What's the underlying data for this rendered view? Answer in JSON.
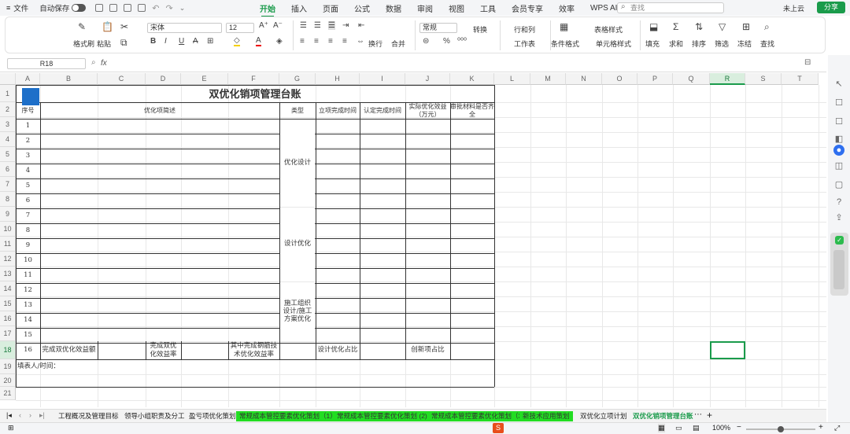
{
  "menu": {
    "file": "文件",
    "autosave": "自动保存"
  },
  "tabs": [
    "开始",
    "插入",
    "页面",
    "公式",
    "数据",
    "审阅",
    "视图",
    "工具",
    "会员专享",
    "效率",
    "WPS AI"
  ],
  "search": {
    "placeholder": "查找"
  },
  "header": {
    "cloud": "未上云",
    "share": "分享"
  },
  "ribbon": {
    "format_painter": "格式刷",
    "paste": "粘贴",
    "font": "宋体",
    "size": "12",
    "wrap": "换行",
    "merge": "合并",
    "number_format": "常规",
    "convert": "转换",
    "rows_cols": "行和列",
    "worksheet": "工作表",
    "cond_format": "条件格式",
    "table_style": "表格样式",
    "cell_style": "单元格样式",
    "fill": "填充",
    "sum": "求和",
    "sort": "排序",
    "filter": "筛选",
    "freeze": "冻结",
    "find": "查找"
  },
  "formula": {
    "cell_ref": "R18",
    "fx": "fx"
  },
  "columns": [
    "A",
    "B",
    "C",
    "D",
    "E",
    "F",
    "G",
    "H",
    "I",
    "J",
    "K",
    "L",
    "M",
    "N",
    "O",
    "P",
    "Q",
    "R",
    "S",
    "T"
  ],
  "rows": [
    "1",
    "2",
    "3",
    "4",
    "5",
    "6",
    "7",
    "8",
    "9",
    "10",
    "11",
    "12",
    "13",
    "14",
    "15",
    "16",
    "17",
    "18",
    "19",
    "20",
    "21"
  ],
  "sheet": {
    "title": "双优化销项管理台账",
    "headers": [
      "序号",
      "优化项简述",
      "类型",
      "立项完成时间",
      "认定完成时间",
      "实际优化效益（万元）",
      "审批材料是否齐全"
    ],
    "row_numbers": [
      "1",
      "2",
      "3",
      "4",
      "5",
      "6",
      "7",
      "8",
      "9",
      "10",
      "11",
      "12",
      "13",
      "14",
      "15"
    ],
    "types": [
      "优化设计",
      "设计优化",
      "施工组织设计/施工方案优化"
    ],
    "summary_index": "16",
    "summary_labels": [
      "完成双优化效益额",
      "完成双优化效益率",
      "其中完成钢筋技术优化效益率",
      "设计优化占比",
      "创新项占比"
    ],
    "footer": "填表人/时间："
  },
  "sheet_tabs": [
    "工程概况及管理目标",
    "领导小组职责及分工",
    "盈亏项优化策划",
    "常规成本管控要素优化策划（1）",
    "常规成本管控要素优化策划 (2)",
    "常规成本管控要素优化策划（3）",
    "新技术应用策划",
    "双优化立项计划",
    "双优化销项管理台账"
  ],
  "status": {
    "zoom": "100%"
  },
  "colors": {
    "accent": "#1a9b4b",
    "highlight_tab": "#22dd22"
  }
}
